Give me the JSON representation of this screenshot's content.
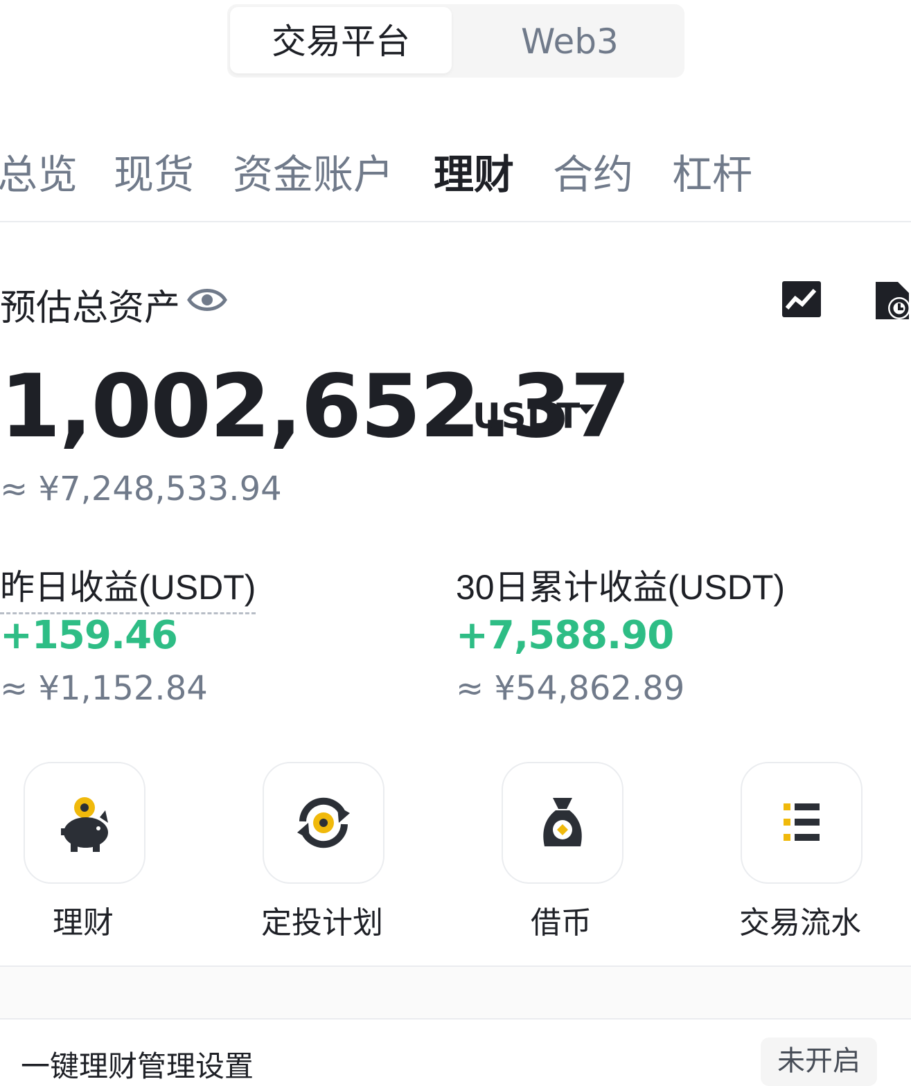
{
  "top_switch": {
    "active_label": "交易平台",
    "inactive_label": "Web3"
  },
  "tabs": [
    {
      "label": "总览",
      "active": false
    },
    {
      "label": "现货",
      "active": false
    },
    {
      "label": "资金账户",
      "active": false
    },
    {
      "label": "理财",
      "active": true
    },
    {
      "label": "合约",
      "active": false
    },
    {
      "label": "杠杆",
      "active": false
    }
  ],
  "overview": {
    "label": "预估总资产",
    "total_value": "1,002,652.37",
    "unit": "USDT",
    "fiat_approx": "≈ ¥7,248,533.94"
  },
  "stats": {
    "yesterday": {
      "label": "昨日收益(USDT)",
      "value": "+159.46",
      "fiat": "≈ ¥1,152.84"
    },
    "thirty_day": {
      "label": "30日累计收益(USDT)",
      "value": "+7,588.90",
      "fiat": "≈ ¥54,862.89"
    }
  },
  "shortcuts": [
    {
      "label": "理财",
      "icon": "piggy-bank-icon"
    },
    {
      "label": "定投计划",
      "icon": "recurring-plan-icon"
    },
    {
      "label": "借币",
      "icon": "money-bag-icon"
    },
    {
      "label": "交易流水",
      "icon": "transaction-list-icon"
    }
  ],
  "auto_invest": {
    "label": "一键理财管理设置",
    "status": "未开启"
  },
  "colors": {
    "accent": "#f0b90b",
    "positive": "#2ebd85",
    "text": "#1e2026",
    "muted": "#707a8a",
    "icon_dark": "#2b2f36"
  }
}
